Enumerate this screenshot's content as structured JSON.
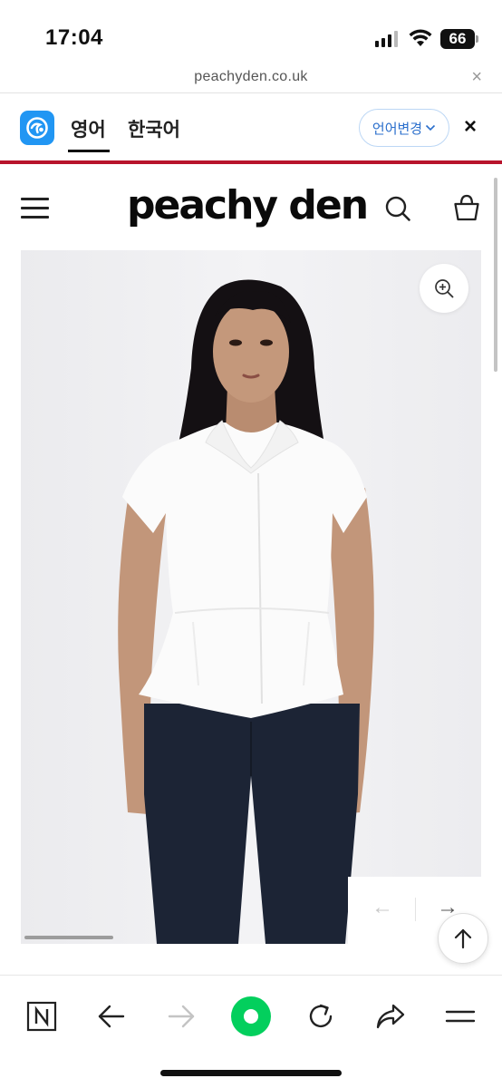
{
  "status_bar": {
    "time": "17:04",
    "battery": "66"
  },
  "browser": {
    "url": "peachyden.co.uk",
    "close_symbol": "×"
  },
  "translate_bar": {
    "tabs": [
      {
        "label": "영어",
        "active": true
      },
      {
        "label": "한국어",
        "active": false
      }
    ],
    "change_language_label": "언어변경",
    "close_symbol": "×",
    "accent_color": "#b8142c"
  },
  "site": {
    "brand": "peachy den",
    "icons": [
      "menu-icon",
      "search-icon",
      "shopping-bag-icon"
    ]
  },
  "gallery": {
    "prev_symbol": "←",
    "next_symbol": "→",
    "zoom_icon": "zoom-in-icon",
    "back_to_top_icon": "arrow-up-icon"
  },
  "toolbar": {
    "items": [
      "naver-n-icon",
      "back-icon",
      "forward-icon",
      "green-circle-icon",
      "refresh-icon",
      "share-icon",
      "menu-icon"
    ],
    "green_color": "#03cf5d"
  }
}
